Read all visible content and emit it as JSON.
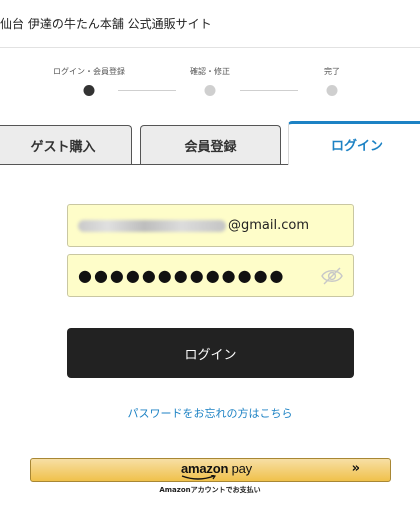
{
  "header": {
    "title": "仙台 伊達の牛たん本舗 公式通販サイト"
  },
  "stepper": {
    "steps": [
      {
        "label": "ログイン・会員登録",
        "active": true
      },
      {
        "label": "確認・修正",
        "active": false
      },
      {
        "label": "完了",
        "active": false
      }
    ]
  },
  "tabs": {
    "guest": "ゲスト購入",
    "member": "会員登録",
    "login": "ログイン",
    "active": "login"
  },
  "form": {
    "email_domain": "@gmail.com",
    "password_mask": "●●●●●●●●●●●●●",
    "eye_icon": "eye-slash-icon"
  },
  "login_button": "ログイン",
  "forgot_link": "パスワードをお忘れの方はこちら",
  "amazon_pay": {
    "logo_main": "amazon",
    "logo_pay": "pay",
    "chevron": "»",
    "subtext": "Amazonアカウントでお支払い"
  },
  "colors": {
    "accent": "#1d82c4",
    "input_bg": "#fefdc9",
    "button_dark": "#222222",
    "amazon_gold": "#f0c14b"
  }
}
